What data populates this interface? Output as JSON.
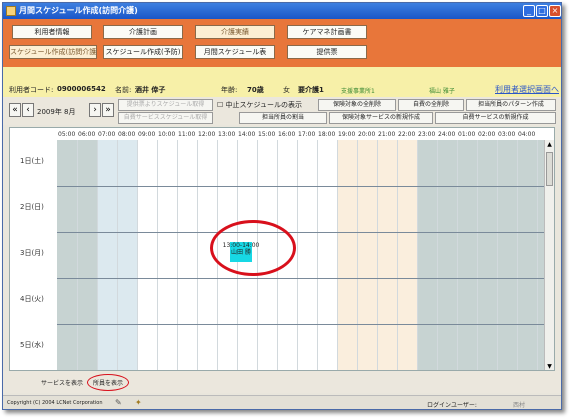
{
  "window": {
    "title": "月間スケジュール作成(訪問介護)"
  },
  "menu": {
    "row1": [
      "利用者情報",
      "介護計画",
      "介護実績",
      "ケアマネ計画書"
    ],
    "row2": [
      "スケジュール作成(訪問介護)",
      "スケジュール作成(予防)",
      "月間スケジュール表",
      "提供票"
    ]
  },
  "info": {
    "code_label": "利用者コード:",
    "code_value": "0900006542",
    "name_label": "名前:",
    "name_value": "酒井 倖子",
    "age_label": "年齢:",
    "age_value": "70歳",
    "gender": "女",
    "care_level": "要介護1",
    "office": "支援事業所1",
    "manager": "福山 雅子",
    "select_link": "利用者選択画面へ"
  },
  "toolbar": {
    "year_month": "2009年 8月",
    "btn_provider_schedule": "提供票よりスケジュール取得",
    "btn_self_service": "自費サービススケジュール取得",
    "chk_cancelled": "中止スケジュールの表示",
    "btn_delete_insured": "保険対象の全削除",
    "btn_delete_self": "自費の全削除",
    "btn_staff_pattern": "担当所員のパターン作成",
    "btn_assign_staff": "担当所員の割当",
    "btn_new_insured": "保険対象サービスの新規作成",
    "btn_new_self": "自費サービスの新規作成"
  },
  "grid": {
    "hours": [
      "05:00",
      "06:00",
      "07:00",
      "08:00",
      "09:00",
      "10:00",
      "11:00",
      "12:00",
      "13:00",
      "14:00",
      "15:00",
      "16:00",
      "17:00",
      "18:00",
      "19:00",
      "20:00",
      "21:00",
      "22:00",
      "23:00",
      "24:00",
      "01:00",
      "02:00",
      "03:00",
      "04:00"
    ],
    "days": [
      "1日(土)",
      "2日(日)",
      "3日(月)",
      "4日(火)",
      "5日(水)"
    ],
    "schedule": {
      "time": "13:00-14:00",
      "staff": "山田 勝"
    }
  },
  "bottom": {
    "service_display": "サービスを表示",
    "staff_display": "所員を表示"
  },
  "footer": {
    "copyright": "Copyright (C) 2004 LCNet Corporation",
    "login_label": "ログインユーザー:",
    "login_user": "西村"
  },
  "colors": {
    "menu_bg": "#e8763a",
    "info_bg": "#f7f0a8",
    "schedule_block": "#17d8e5",
    "annotation_circle": "#d8101c"
  }
}
